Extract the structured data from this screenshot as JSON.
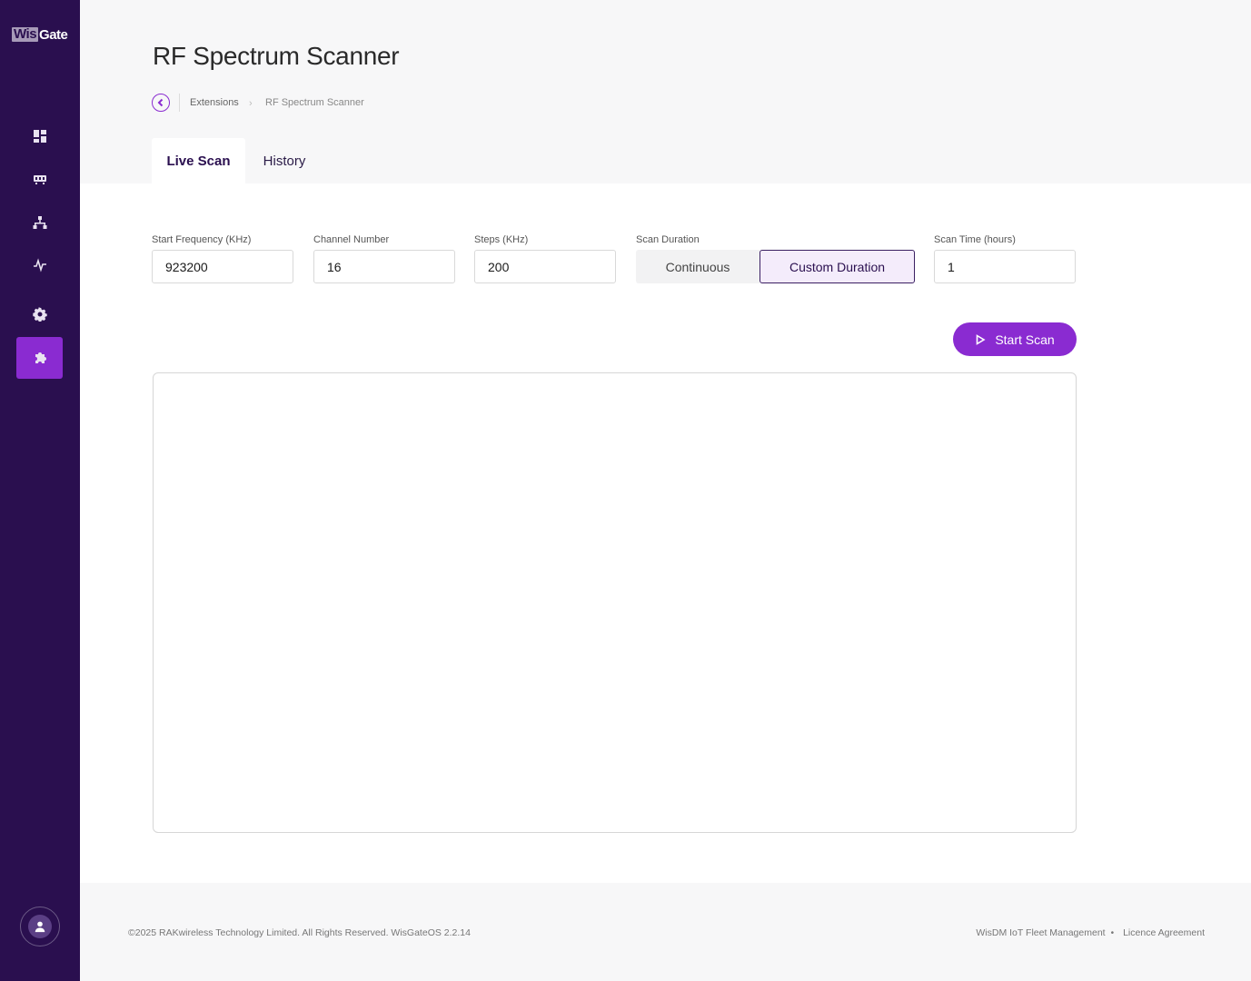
{
  "brand": {
    "logo_part1": "Wis",
    "logo_part2": "Gate"
  },
  "sidebar": {
    "items": [
      {
        "name": "dashboard",
        "icon": "dashboard-icon"
      },
      {
        "name": "gateway",
        "icon": "gateway-icon"
      },
      {
        "name": "network",
        "icon": "network-icon"
      },
      {
        "name": "activity",
        "icon": "activity-icon"
      },
      {
        "name": "settings",
        "icon": "gear-icon"
      },
      {
        "name": "extensions",
        "icon": "puzzle-icon",
        "active": true
      }
    ],
    "user_icon": "user-icon"
  },
  "header": {
    "title": "RF Spectrum Scanner",
    "breadcrumb": {
      "parent": "Extensions",
      "current": "RF Spectrum Scanner"
    }
  },
  "tabs": [
    {
      "label": "Live Scan",
      "active": true
    },
    {
      "label": "History",
      "active": false
    }
  ],
  "form": {
    "start_frequency": {
      "label": "Start Frequency (KHz)",
      "value": "923200"
    },
    "channel_number": {
      "label": "Channel Number",
      "value": "16"
    },
    "steps": {
      "label": "Steps (KHz)",
      "value": "200"
    },
    "scan_duration": {
      "label": "Scan Duration",
      "options": [
        "Continuous",
        "Custom Duration"
      ],
      "selected": "Custom Duration"
    },
    "scan_time": {
      "label": "Scan Time (hours)",
      "value": "1"
    }
  },
  "actions": {
    "start_scan": "Start Scan"
  },
  "footer": {
    "copyright": "©2025 RAKwireless Technology Limited. All Rights Reserved. WisGateOS 2.2.14",
    "link1": "WisDM IoT Fleet Management",
    "separator": "•",
    "link2": "Licence Agreement"
  },
  "colors": {
    "sidebar_bg": "#2a0f4f",
    "accent": "#8a2bd1",
    "page_bg": "#f7f7f8"
  }
}
